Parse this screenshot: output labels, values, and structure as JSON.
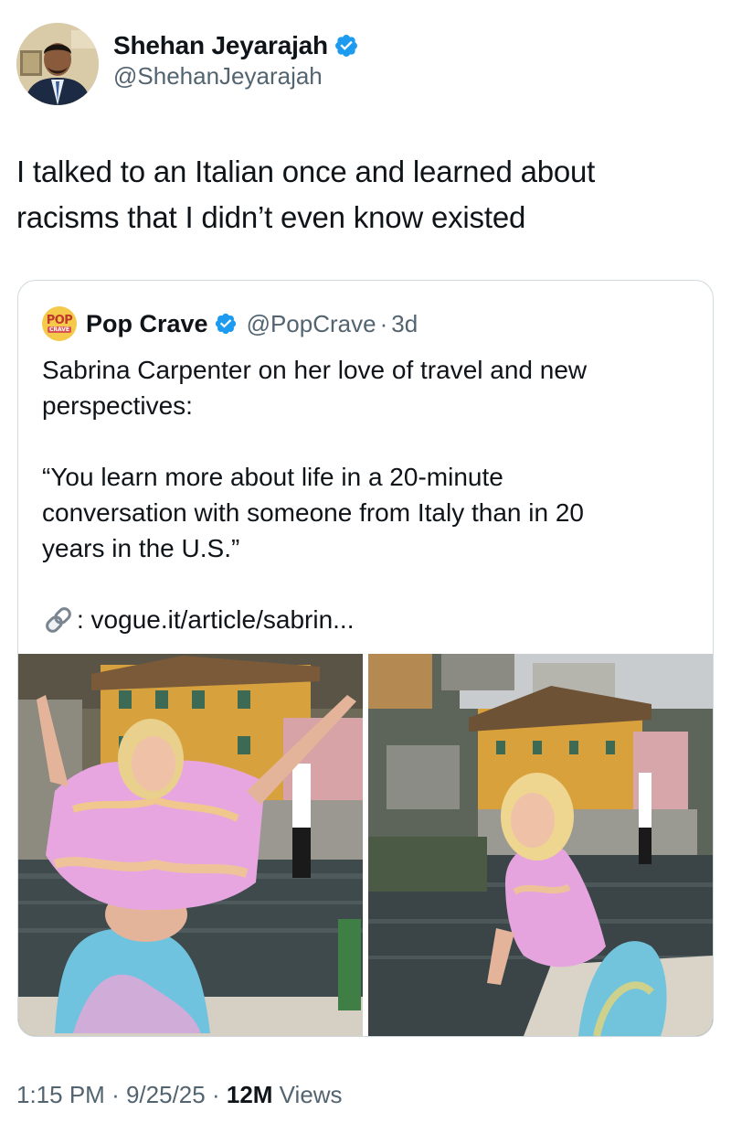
{
  "author": {
    "display_name": "Shehan Jeyarajah",
    "handle": "@ShehanJeyarajah",
    "verified": true,
    "avatar_icon": "profile-photo"
  },
  "tweet": {
    "text_line1": "I talked to an Italian once and learned about",
    "text_line2": "racisms that I didn’t even know existed"
  },
  "quoted_tweet": {
    "avatar_label_top": "POP",
    "avatar_label_bottom": "CRAVE",
    "display_name": "Pop Crave",
    "verified": true,
    "handle": "@PopCrave",
    "separator": "·",
    "time": "3d",
    "text_line1": "Sabrina Carpenter on her love of travel and new",
    "text_line2": "perspectives:",
    "quote_line1": "“You learn more about life in a 20-minute",
    "quote_line2": "conversation with someone from Italy than in 20",
    "quote_line3": "years in the U.S.”",
    "link_icon": "link-icon",
    "link_text": ": vogue.it/article/sabrin...",
    "photos": [
      "photo-left",
      "photo-right"
    ]
  },
  "footer": {
    "time": "1:15 PM",
    "sep1": "·",
    "date": "9/25/25",
    "sep2": "·",
    "views_count": "12M",
    "views_label": "Views"
  },
  "colors": {
    "verified_blue": "#1d9bf0",
    "secondary_text": "#536471",
    "border": "#cfd9de"
  }
}
